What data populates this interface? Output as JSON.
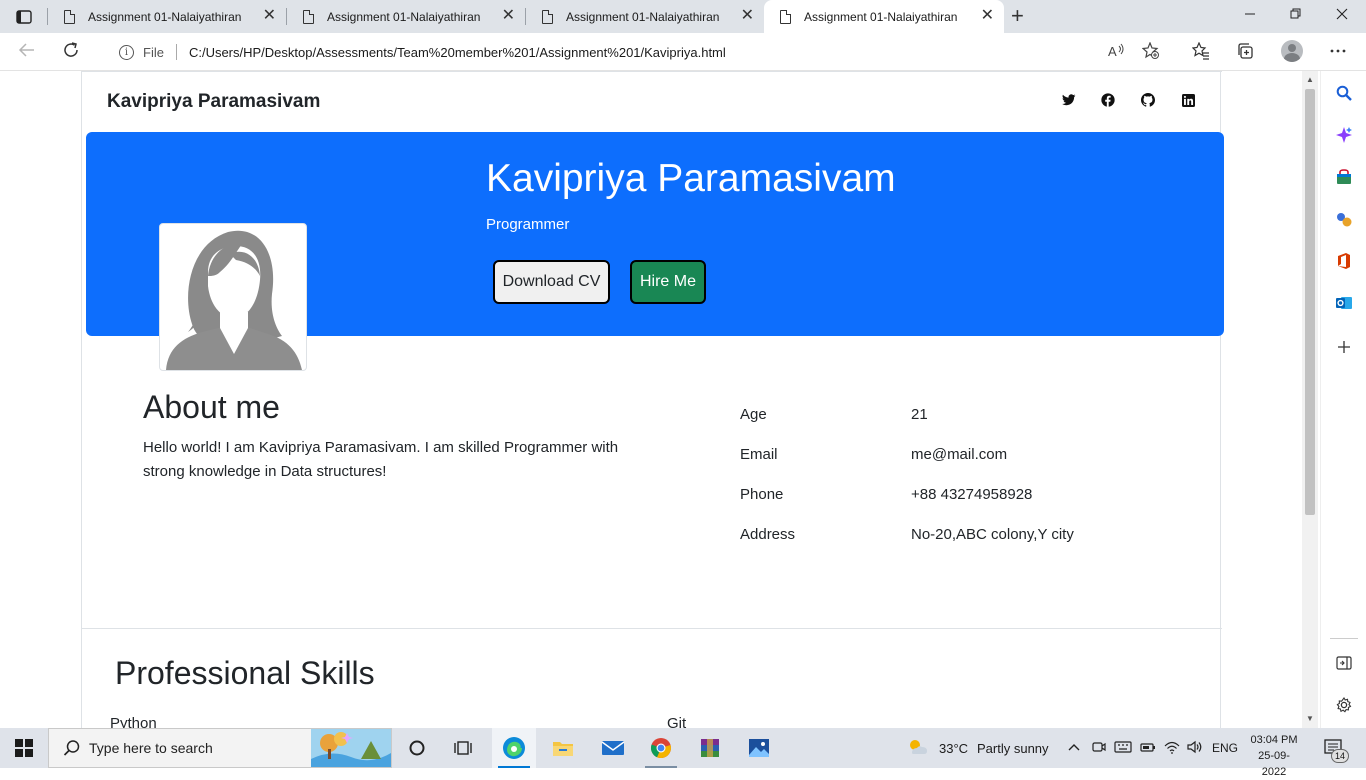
{
  "browser": {
    "tabs": [
      {
        "title": "Assignment 01-Nalaiyathiran",
        "active": false
      },
      {
        "title": "Assignment 01-Nalaiyathiran",
        "active": false
      },
      {
        "title": "Assignment 01-Nalaiyathiran",
        "active": false
      },
      {
        "title": "Assignment 01-Nalaiyathiran",
        "active": true
      }
    ],
    "tab_close_glyph": "✕",
    "new_tab_glyph": "+",
    "address": {
      "scheme_label": "File",
      "url": "C:/Users/HP/Desktop/Assessments/Team%20member%201/Assignment%201/Kavipriya.html"
    },
    "icons": [
      "tab-actions-icon",
      "back-icon",
      "refresh-icon",
      "info-icon",
      "read-aloud-icon",
      "add-favorite-icon",
      "favorites-icon",
      "collections-icon",
      "profile-icon",
      "more-icon",
      "minimize-icon",
      "restore-icon",
      "close-icon"
    ]
  },
  "page": {
    "brand": "Kavipriya Paramasivam",
    "social": [
      "twitter-icon",
      "facebook-icon",
      "github-icon",
      "linkedin-icon"
    ],
    "hero": {
      "name": "Kavipriya Paramasivam",
      "role": "Programmer",
      "download_label": "Download CV",
      "hire_label": "Hire Me",
      "color": "#0d6efd"
    },
    "about": {
      "title": "About me",
      "text": "Hello world! I am Kavipriya Paramasivam. I am skilled Programmer with strong knowledge in Data structures!"
    },
    "info": [
      {
        "label": "Age",
        "value": "21"
      },
      {
        "label": "Email",
        "value": "me@mail.com"
      },
      {
        "label": "Phone",
        "value": "+88 43274958928"
      },
      {
        "label": "Address",
        "value": "No-20,ABC colony,Y city"
      }
    ],
    "skills": {
      "title": "Professional Skills",
      "items": [
        "Python",
        "Git"
      ]
    }
  },
  "taskbar": {
    "search_placeholder": "Type here to search",
    "weather_temp": "33°C",
    "weather_desc": "Partly sunny",
    "language": "ENG",
    "time": "03:04 PM",
    "date": "25-09-2022",
    "notification_count": "14"
  }
}
